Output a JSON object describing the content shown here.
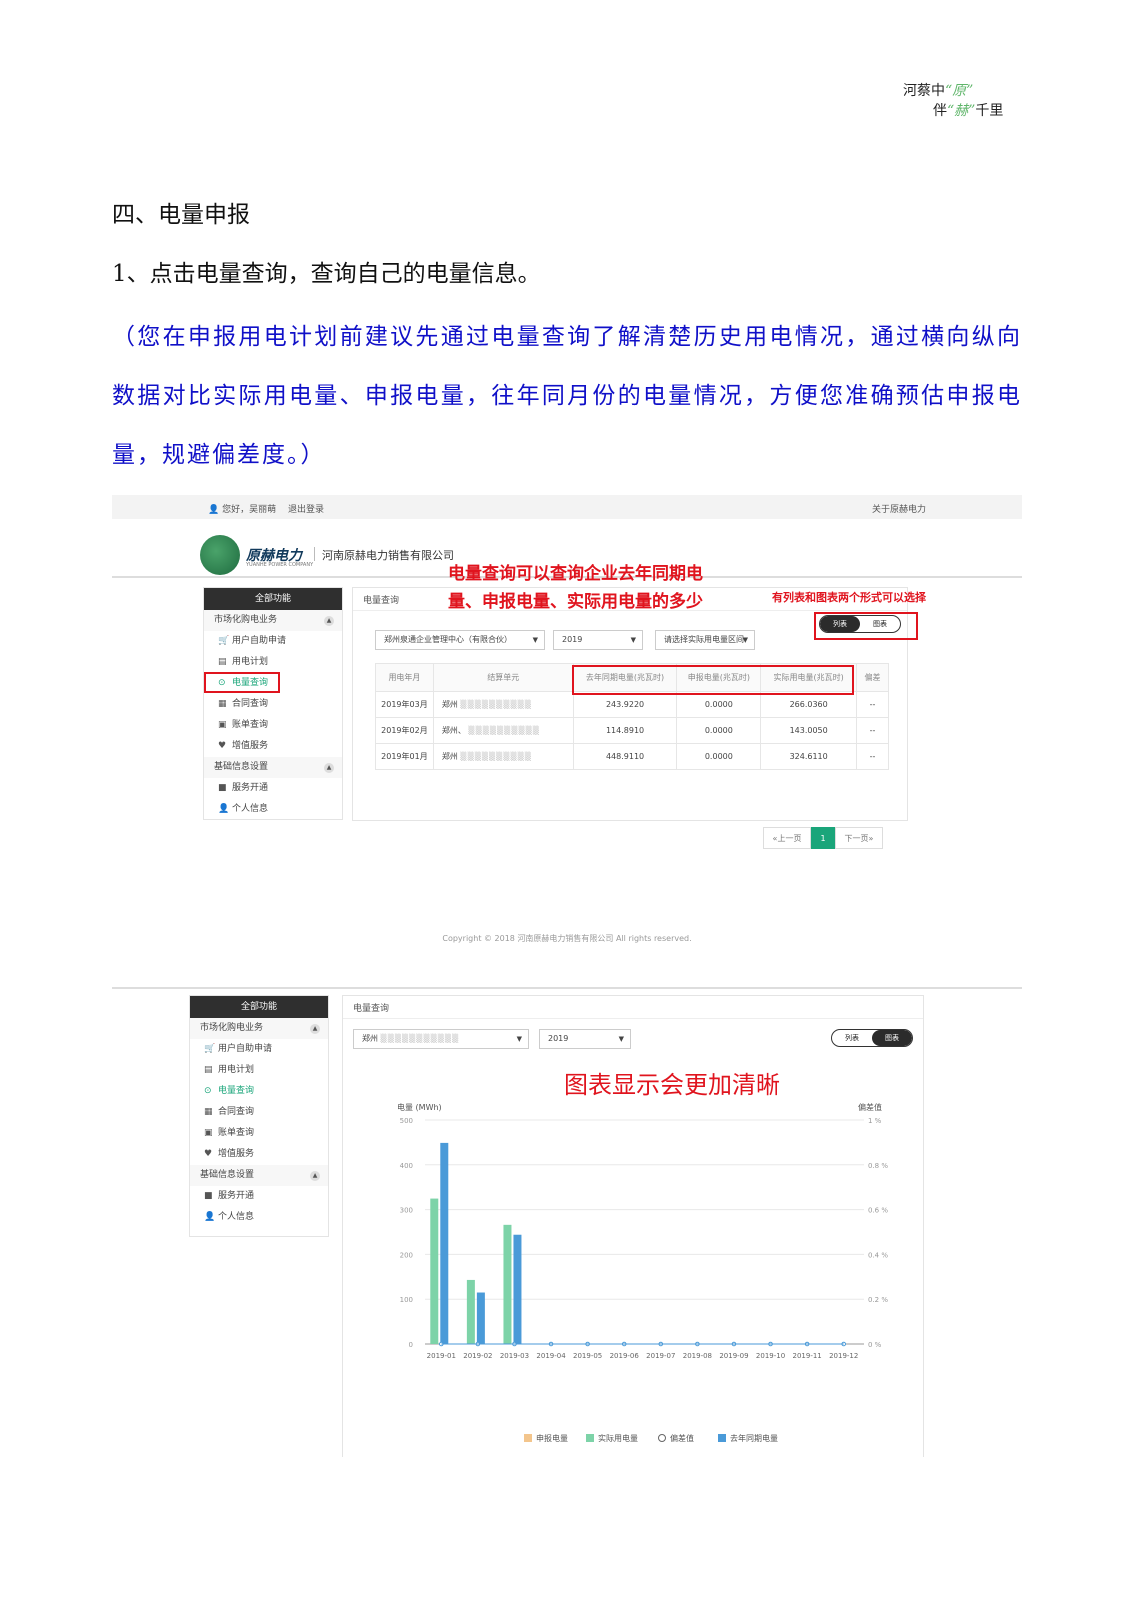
{
  "corner_logo": {
    "line1_a": "河蔡中",
    "line1_b": "“原”",
    "line2_a": "伴",
    "line2_b": "“赫”",
    "line2_c": "千里"
  },
  "doc": {
    "heading": "四、电量申报",
    "step": "1、点击电量查询，查询自己的电量信息。",
    "note": "（您在申报用电计划前建议先通过电量查询了解清楚历史用电情况，通过横向纵向数据对比实际用电量、申报电量，往年同月份的电量情况，方便您准确预估申报电量，规避偏差度。）"
  },
  "shot1": {
    "topbar": {
      "greeting": "您好，吴丽萌",
      "logout": "退出登录",
      "about": "关于原赫电力"
    },
    "brand": {
      "name": "原赫电力",
      "subname": "YUANHE POWER COMPANY",
      "company": "河南原赫电力销售有限公司"
    },
    "sidebar": {
      "header": "全部功能",
      "group1": "市场化购电业务",
      "items1": [
        "用户自助申请",
        "用电计划",
        "电量查询",
        "合同查询",
        "账单查询",
        "增值服务"
      ],
      "group2": "基础信息设置",
      "items2": [
        "服务开通",
        "个人信息"
      ]
    },
    "panel_title": "电量查询",
    "filters": {
      "company": "郑州泉通企业管理中心（有限合伙）",
      "year": "2019",
      "range": "请选择实际用电量区间"
    },
    "toggle": {
      "list": "列表",
      "chart": "图表"
    },
    "table": {
      "headers": [
        "用电年月",
        "结算单元",
        "去年同期电量(兆瓦时)",
        "申报电量(兆瓦时)",
        "实际用电量(兆瓦时)",
        "偏差"
      ],
      "rows": [
        [
          "2019年03月",
          "郑州",
          "243.9220",
          "0.0000",
          "266.0360",
          "--"
        ],
        [
          "2019年02月",
          "郑州、",
          "114.8910",
          "0.0000",
          "143.0050",
          "--"
        ],
        [
          "2019年01月",
          "郑州",
          "448.9110",
          "0.0000",
          "324.6110",
          "--"
        ]
      ]
    },
    "pager": {
      "prev": "«上一页",
      "current": "1",
      "next": "下一页»"
    },
    "annotation_main": [
      "电量查询可以查询企业去年同期电",
      "量、申报电量、实际用电量的多少"
    ],
    "annotation_toggle": "有列表和图表两个形式可以选择",
    "copyright": "Copyright © 2018 河南原赫电力销售有限公司 All rights reserved."
  },
  "shot2": {
    "sidebar": {
      "header": "全部功能",
      "group1": "市场化购电业务",
      "items1": [
        "用户自助申请",
        "用电计划",
        "电量查询",
        "合同查询",
        "账单查询",
        "增值服务"
      ],
      "group2": "基础信息设置",
      "items2": [
        "服务开通",
        "个人信息"
      ]
    },
    "panel_title": "电量查询",
    "filters": {
      "company": "郑州",
      "year": "2019"
    },
    "toggle": {
      "list": "列表",
      "chart": "图表"
    },
    "annotation": "图表显示会更加清晰",
    "colors": {
      "declared": "#f3c58c",
      "actual": "#7dd3a8",
      "deviation": "#666666",
      "last_year": "#4a9ad8"
    }
  },
  "chart_data": {
    "type": "bar",
    "categories": [
      "2019-01",
      "2019-02",
      "2019-03",
      "2019-04",
      "2019-05",
      "2019-06",
      "2019-07",
      "2019-08",
      "2019-09",
      "2019-10",
      "2019-11",
      "2019-12"
    ],
    "series": [
      {
        "name": "申报电量",
        "values": [
          0,
          0,
          0,
          0,
          0,
          0,
          0,
          0,
          0,
          0,
          0,
          0
        ]
      },
      {
        "name": "实际用电量",
        "values": [
          324.6,
          143.0,
          266.0,
          0,
          0,
          0,
          0,
          0,
          0,
          0,
          0,
          0
        ]
      },
      {
        "name": "偏差值",
        "values": [
          0,
          0,
          0,
          0,
          0,
          0,
          0,
          0,
          0,
          0,
          0,
          0
        ],
        "axis": "right",
        "style": "line"
      },
      {
        "name": "去年同期电量",
        "values": [
          448.9,
          114.9,
          243.9,
          0,
          0,
          0,
          0,
          0,
          0,
          0,
          0,
          0
        ]
      }
    ],
    "ylabel": "电量 (MWh)",
    "ylim": [
      0,
      500
    ],
    "yticks": [
      0,
      100,
      200,
      300,
      400,
      500
    ],
    "y2label": "偏差值",
    "y2ticks": [
      "0 %",
      "0.2 %",
      "0.4 %",
      "0.6 %",
      "0.8 %",
      "1 %"
    ],
    "grid": true,
    "legend_position": "bottom"
  }
}
